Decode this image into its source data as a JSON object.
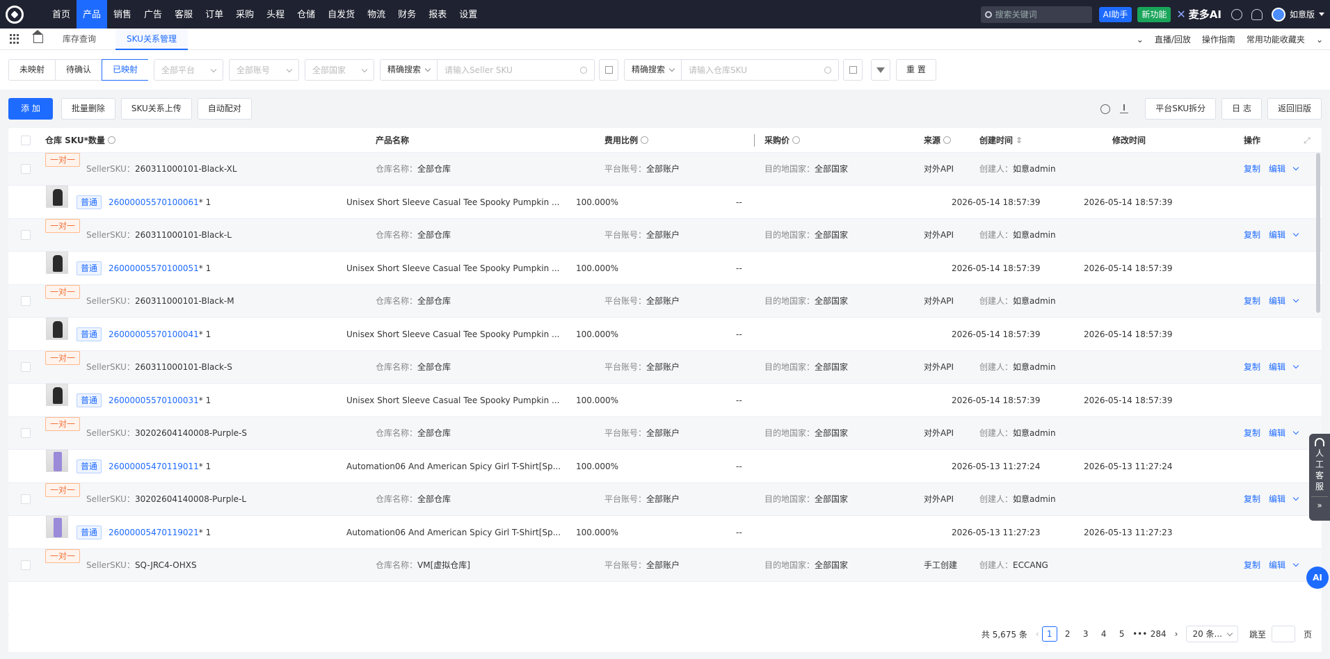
{
  "nav": {
    "items": [
      "首页",
      "产品",
      "销售",
      "广告",
      "客服",
      "订单",
      "采购",
      "头程",
      "仓储",
      "自发货",
      "物流",
      "财务",
      "报表",
      "设置"
    ],
    "active_index": 1,
    "search_placeholder": "搜索关键词",
    "ai_button": "AI助手",
    "new_feature": "新功能",
    "brand": "麦多AI",
    "user": "如意版"
  },
  "tabs": {
    "items": [
      "库存查询",
      "SKU关系管理"
    ],
    "active_index": 1,
    "right": [
      "直播/回放",
      "操作指南",
      "常用功能收藏夹"
    ]
  },
  "filters": {
    "segments": [
      "未映射",
      "待确认",
      "已映射"
    ],
    "active_segment": 2,
    "platform_placeholder": "全部平台",
    "account_placeholder": "全部账号",
    "country_placeholder": "全部国家",
    "search1_mode": "精确搜索",
    "search1_placeholder": "请输入Seller SKU",
    "search2_mode": "精确搜索",
    "search2_placeholder": "请输入仓库SKU",
    "reset": "重 置"
  },
  "toolbar": {
    "add": "添 加",
    "batch_delete": "批量删除",
    "upload": "SKU关系上传",
    "auto_match": "自动配对",
    "platform_split": "平台SKU拆分",
    "log": "日 志",
    "old_version": "返回旧版"
  },
  "table": {
    "headers": {
      "sku_qty": "仓库 SKU*数量",
      "product_name": "产品名称",
      "fee_ratio": "费用比例",
      "purchase_price": "采购价",
      "source": "来源",
      "created": "创建时间",
      "modified": "修改时间",
      "actions": "操作"
    },
    "labels": {
      "seller_sku": "SellerSKU：",
      "warehouse": "仓库名称：",
      "account": "平台账号：",
      "country": "目的地国家：",
      "creator": "创建人：",
      "copy": "复制",
      "edit": "编辑",
      "normal": "普通"
    },
    "groups": [
      {
        "mapping": "一对一",
        "seller_sku": "260311000101-Black-XL",
        "warehouse": "全部仓库",
        "account": "全部账户",
        "country": "全部国家",
        "source": "对外API",
        "creator": "如意admin",
        "detail": {
          "thumb": "dark",
          "sku": "26000005570100061",
          "qty": "* 1",
          "name": "Unisex Short Sleeve Casual Tee Spooky Pumpkin ...",
          "fee": "100.000%",
          "price": "--",
          "created": "2026-05-14 18:57:39",
          "modified": "2026-05-14 18:57:39"
        }
      },
      {
        "mapping": "一对一",
        "seller_sku": "260311000101-Black-L",
        "warehouse": "全部仓库",
        "account": "全部账户",
        "country": "全部国家",
        "source": "对外API",
        "creator": "如意admin",
        "detail": {
          "thumb": "dark",
          "sku": "26000005570100051",
          "qty": "* 1",
          "name": "Unisex Short Sleeve Casual Tee Spooky Pumpkin ...",
          "fee": "100.000%",
          "price": "--",
          "created": "2026-05-14 18:57:39",
          "modified": "2026-05-14 18:57:39"
        }
      },
      {
        "mapping": "一对一",
        "seller_sku": "260311000101-Black-M",
        "warehouse": "全部仓库",
        "account": "全部账户",
        "country": "全部国家",
        "source": "对外API",
        "creator": "如意admin",
        "detail": {
          "thumb": "dark",
          "sku": "26000005570100041",
          "qty": "* 1",
          "name": "Unisex Short Sleeve Casual Tee Spooky Pumpkin ...",
          "fee": "100.000%",
          "price": "--",
          "created": "2026-05-14 18:57:39",
          "modified": "2026-05-14 18:57:39"
        }
      },
      {
        "mapping": "一对一",
        "seller_sku": "260311000101-Black-S",
        "warehouse": "全部仓库",
        "account": "全部账户",
        "country": "全部国家",
        "source": "对外API",
        "creator": "如意admin",
        "detail": {
          "thumb": "dark",
          "sku": "26000005570100031",
          "qty": "* 1",
          "name": "Unisex Short Sleeve Casual Tee Spooky Pumpkin ...",
          "fee": "100.000%",
          "price": "--",
          "created": "2026-05-14 18:57:39",
          "modified": "2026-05-14 18:57:39"
        }
      },
      {
        "mapping": "一对一",
        "seller_sku": "30202604140008-Purple-S",
        "warehouse": "全部仓库",
        "account": "全部账户",
        "country": "全部国家",
        "source": "对外API",
        "creator": "如意admin",
        "detail": {
          "thumb": "purple",
          "sku": "26000005470119011",
          "qty": "* 1",
          "name": "Automation06 And American Spicy Girl T-Shirt[Sp...",
          "fee": "100.000%",
          "price": "--",
          "created": "2026-05-13 11:27:24",
          "modified": "2026-05-13 11:27:24"
        }
      },
      {
        "mapping": "一对一",
        "seller_sku": "30202604140008-Purple-L",
        "warehouse": "全部仓库",
        "account": "全部账户",
        "country": "全部国家",
        "source": "对外API",
        "creator": "如意admin",
        "detail": {
          "thumb": "purple",
          "sku": "26000005470119021",
          "qty": "* 1",
          "name": "Automation06 And American Spicy Girl T-Shirt[Sp...",
          "fee": "100.000%",
          "price": "--",
          "created": "2026-05-13 11:27:23",
          "modified": "2026-05-13 11:27:23"
        }
      },
      {
        "mapping": "一对一",
        "seller_sku": "SQ-JRC4-OHXS",
        "warehouse": "VM[虚拟仓库]",
        "account": "全部账户",
        "country": "全部国家",
        "source": "手工创建",
        "creator": "ECCANG",
        "detail": null
      }
    ]
  },
  "pager": {
    "total": "共 5,675 条",
    "pages": [
      "1",
      "2",
      "3",
      "4",
      "5",
      "•••",
      "284"
    ],
    "current": "1",
    "page_size": "20 条...",
    "goto": "跳至",
    "page_unit": "页"
  },
  "side": {
    "service": "人工客服",
    "ai": "AI"
  }
}
